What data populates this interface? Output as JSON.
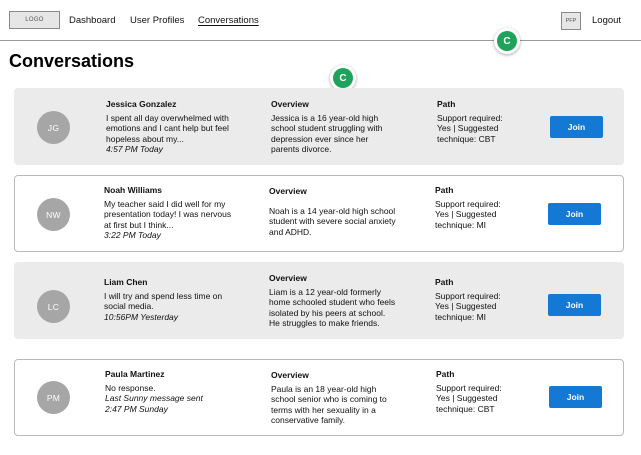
{
  "header": {
    "logo": "LOGO",
    "nav": [
      "Dashboard",
      "User Profiles",
      "Conversations"
    ],
    "pfp": "PFP",
    "logout": "Logout"
  },
  "page_title": "Conversations",
  "collaborator_initial": "C",
  "overview_heading": "Overview",
  "path_heading": "Path",
  "join_label": "Join",
  "conversations": [
    {
      "initials": "JG",
      "name": "Jessica Gonzalez",
      "message": "I spent all day overwhelmed with emotions and I cant help but feel hopeless about my...",
      "time": "4:57 PM Today",
      "overview": "Jessica is a 16 year-old high school student struggling with depression ever since her parents divorce.",
      "path": "Support required: Yes | Suggested technique: CBT"
    },
    {
      "initials": "NW",
      "name": "Noah Williams",
      "message": "My teacher said I did well for my presentation today! I was nervous at first but I think...",
      "time": "3:22 PM Today",
      "overview": "Noah is a 14 year-old high school student with severe social anxiety and ADHD.",
      "path": "Support required: Yes | Suggested technique: MI"
    },
    {
      "initials": "LC",
      "name": "Liam Chen",
      "message": "I will try and spend less time on social media.",
      "time": "10:56PM Yesterday",
      "overview": "Liam is a 12 year-old formerly home schooled student who feels isolated by his peers at school. He struggles to make friends.",
      "path": "Support required: Yes | Suggested technique: MI"
    },
    {
      "initials": "PM",
      "name": "Paula Martinez",
      "message": "No response.",
      "time": "Last Sunny message sent 2:47 PM Sunday",
      "overview": "Paula is an 18 year-old high school senior who is coming to terms with her sexuality in a conservative family.",
      "path": "Support required: Yes | Suggested technique: CBT"
    }
  ]
}
